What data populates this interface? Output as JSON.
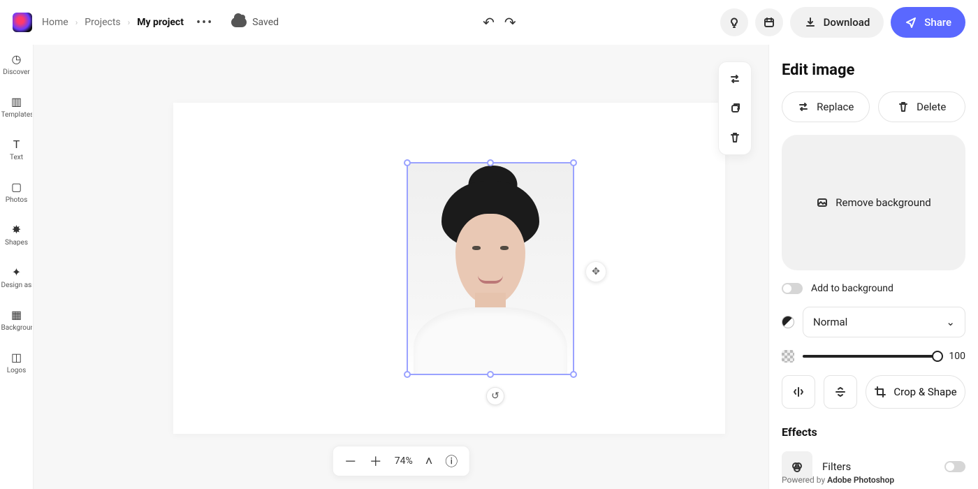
{
  "breadcrumbs": {
    "home": "Home",
    "projects": "Projects",
    "current": "My project"
  },
  "saved_label": "Saved",
  "top_actions": {
    "download": "Download",
    "share": "Share"
  },
  "left_rail": {
    "items": [
      {
        "label": "Discover",
        "icon": "compass-icon"
      },
      {
        "label": "Templates",
        "icon": "layout-icon"
      },
      {
        "label": "Text",
        "icon": "text-icon"
      },
      {
        "label": "Photos",
        "icon": "image-icon"
      },
      {
        "label": "Shapes",
        "icon": "gear-icon"
      },
      {
        "label": "Design assets",
        "icon": "sparkle-icon"
      },
      {
        "label": "Backgrounds",
        "icon": "grid-icon"
      },
      {
        "label": "Logos",
        "icon": "badge-icon"
      }
    ]
  },
  "canvas": {
    "zoom_label": "74%"
  },
  "panel": {
    "title": "Edit image",
    "replace": "Replace",
    "delete": "Delete",
    "remove_bg": "Remove background",
    "add_to_bg": "Add to background",
    "blend_mode": "Normal",
    "opacity_value": "100",
    "crop_shape": "Crop & Shape",
    "effects_title": "Effects",
    "filters_label": "Filters",
    "footer_prefix": "Powered by ",
    "footer_brand": "Adobe Photoshop"
  }
}
